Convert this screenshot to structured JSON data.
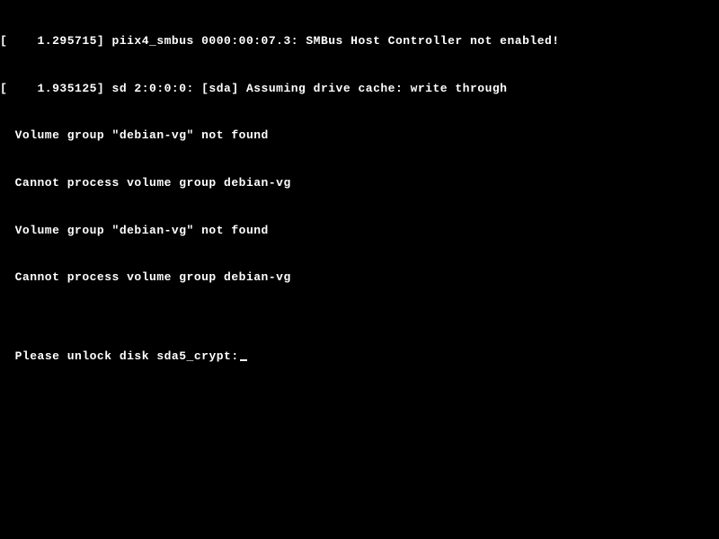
{
  "boot_messages": [
    "[    1.295715] piix4_smbus 0000:00:07.3: SMBus Host Controller not enabled!",
    "[    1.935125] sd 2:0:0:0: [sda] Assuming drive cache: write through",
    "  Volume group \"debian-vg\" not found",
    "  Cannot process volume group debian-vg",
    "  Volume group \"debian-vg\" not found",
    "  Cannot process volume group debian-vg"
  ],
  "prompt": "Please unlock disk sda5_crypt:"
}
